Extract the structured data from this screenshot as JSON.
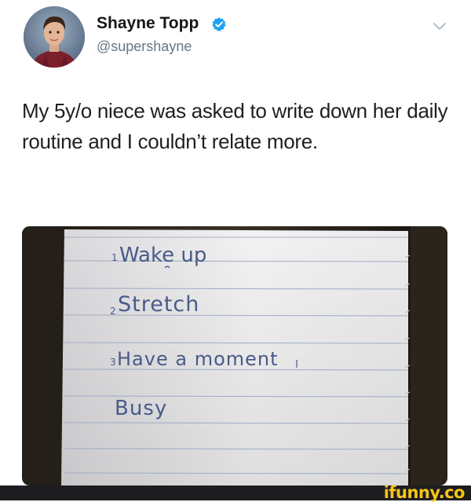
{
  "tweet": {
    "display_name": "Shayne Topp",
    "handle": "@supershayne",
    "text": "My 5y/o niece was asked to write down her daily routine and I couldn’t relate more."
  },
  "note": {
    "lines": [
      {
        "num": "1",
        "text": "Wake up"
      },
      {
        "num": "2",
        "text": "Stretch"
      },
      {
        "num": "3",
        "text": "Have a moment"
      },
      {
        "num": "",
        "text": "Busy"
      }
    ]
  },
  "watermark": {
    "brand": "ifunny.co"
  },
  "colors": {
    "verified_badge": "#1da1f2",
    "handle_gray": "#657786",
    "watermark_yellow": "#f5c518"
  },
  "icons": [
    "verified-badge-icon",
    "chevron-down-icon"
  ]
}
